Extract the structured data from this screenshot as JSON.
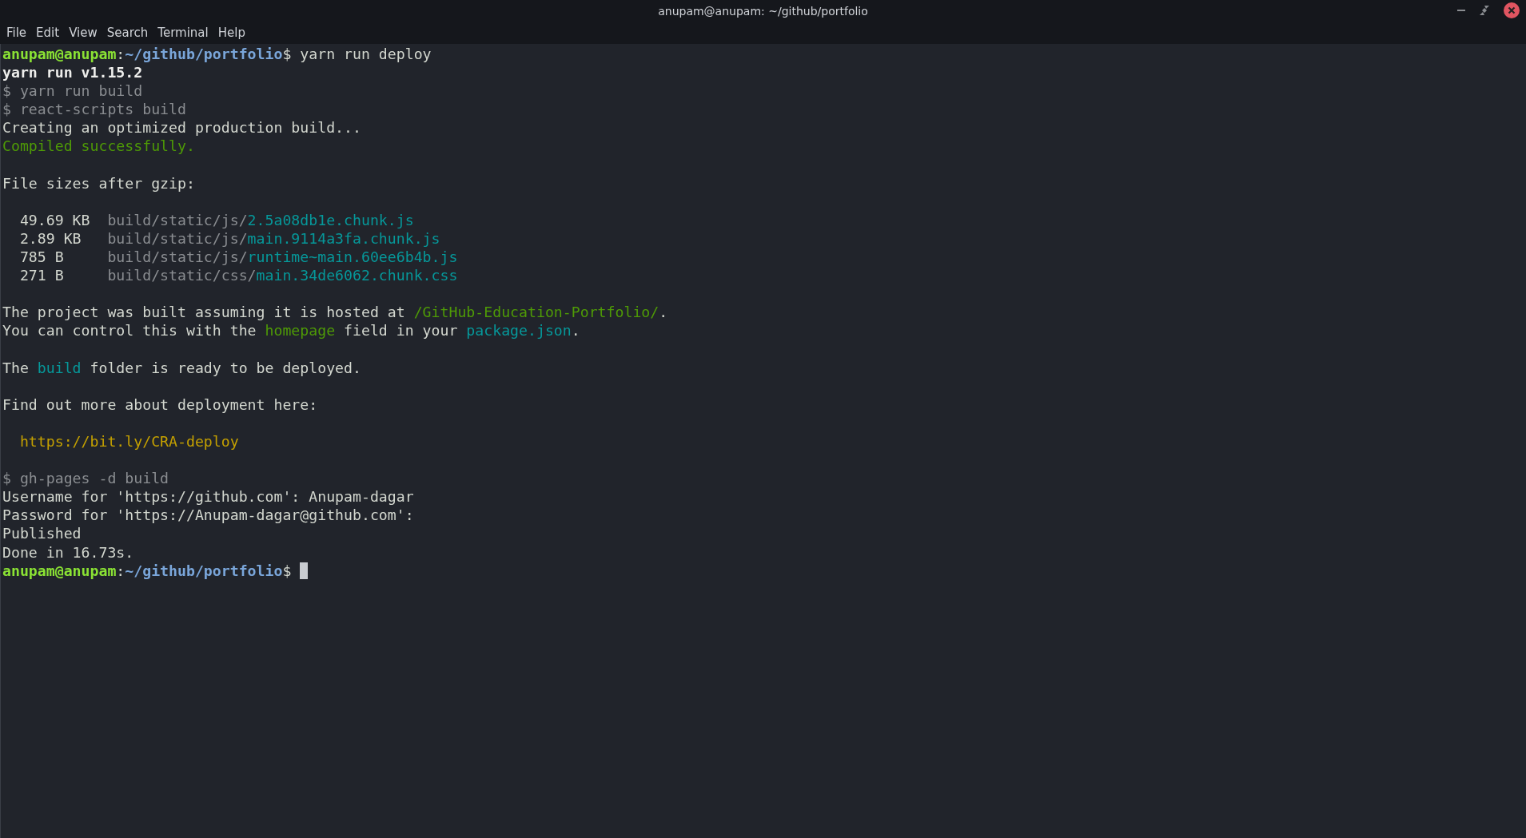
{
  "window": {
    "title": "anupam@anupam: ~/github/portfolio"
  },
  "menu": [
    "File",
    "Edit",
    "View",
    "Search",
    "Terminal",
    "Help"
  ],
  "lines": [
    {
      "kind": "text",
      "segments": [
        {
          "kind": "user",
          "text": "anupam@anupam"
        },
        {
          "kind": "normal",
          "text": ":"
        },
        {
          "kind": "path",
          "text": "~/github/portfolio"
        },
        {
          "kind": "normal",
          "text": "$ yarn run deploy"
        }
      ]
    },
    {
      "kind": "text",
      "segments": [
        {
          "kind": "bold",
          "text": "yarn run v1.15.2"
        }
      ]
    },
    {
      "kind": "text",
      "segments": [
        {
          "kind": "dim",
          "text": "$ yarn run build"
        }
      ]
    },
    {
      "kind": "text",
      "segments": [
        {
          "kind": "dim",
          "text": "$ react-scripts build"
        }
      ]
    },
    {
      "kind": "text",
      "segments": [
        {
          "kind": "normal",
          "text": "Creating an optimized production build..."
        }
      ]
    },
    {
      "kind": "text",
      "segments": [
        {
          "kind": "green",
          "text": "Compiled successfully."
        }
      ]
    },
    {
      "kind": "blank"
    },
    {
      "kind": "text",
      "segments": [
        {
          "kind": "normal",
          "text": "File sizes after gzip:"
        }
      ]
    },
    {
      "kind": "blank"
    },
    {
      "kind": "text",
      "segments": [
        {
          "kind": "normal",
          "text": "  49.69 KB  "
        },
        {
          "kind": "dim",
          "text": "build/static/js/"
        },
        {
          "kind": "cyan",
          "text": "2.5a08db1e.chunk.js"
        }
      ]
    },
    {
      "kind": "text",
      "segments": [
        {
          "kind": "normal",
          "text": "  2.89 KB   "
        },
        {
          "kind": "dim",
          "text": "build/static/js/"
        },
        {
          "kind": "cyan",
          "text": "main.9114a3fa.chunk.js"
        }
      ]
    },
    {
      "kind": "text",
      "segments": [
        {
          "kind": "normal",
          "text": "  785 B     "
        },
        {
          "kind": "dim",
          "text": "build/static/js/"
        },
        {
          "kind": "cyan",
          "text": "runtime~main.60ee6b4b.js"
        }
      ]
    },
    {
      "kind": "text",
      "segments": [
        {
          "kind": "normal",
          "text": "  271 B     "
        },
        {
          "kind": "dim",
          "text": "build/static/css/"
        },
        {
          "kind": "cyan",
          "text": "main.34de6062.chunk.css"
        }
      ]
    },
    {
      "kind": "blank"
    },
    {
      "kind": "text",
      "segments": [
        {
          "kind": "normal",
          "text": "The project was built assuming it is hosted at "
        },
        {
          "kind": "green",
          "text": "/GitHub-Education-Portfolio/"
        },
        {
          "kind": "normal",
          "text": "."
        }
      ]
    },
    {
      "kind": "text",
      "segments": [
        {
          "kind": "normal",
          "text": "You can control this with the "
        },
        {
          "kind": "green",
          "text": "homepage"
        },
        {
          "kind": "normal",
          "text": " field in your "
        },
        {
          "kind": "cyan",
          "text": "package.json"
        },
        {
          "kind": "normal",
          "text": "."
        }
      ]
    },
    {
      "kind": "blank"
    },
    {
      "kind": "text",
      "segments": [
        {
          "kind": "normal",
          "text": "The "
        },
        {
          "kind": "cyan",
          "text": "build"
        },
        {
          "kind": "normal",
          "text": " folder is ready to be deployed."
        }
      ]
    },
    {
      "kind": "blank"
    },
    {
      "kind": "text",
      "segments": [
        {
          "kind": "normal",
          "text": "Find out more about deployment here:"
        }
      ]
    },
    {
      "kind": "blank"
    },
    {
      "kind": "text",
      "segments": [
        {
          "kind": "yellow",
          "text": "  https://bit.ly/CRA-deploy"
        }
      ]
    },
    {
      "kind": "blank"
    },
    {
      "kind": "text",
      "segments": [
        {
          "kind": "dim",
          "text": "$ gh-pages -d build"
        }
      ]
    },
    {
      "kind": "text",
      "segments": [
        {
          "kind": "normal",
          "text": "Username for 'https://github.com': Anupam-dagar"
        }
      ]
    },
    {
      "kind": "text",
      "segments": [
        {
          "kind": "normal",
          "text": "Password for 'https://Anupam-dagar@github.com':"
        }
      ]
    },
    {
      "kind": "text",
      "segments": [
        {
          "kind": "normal",
          "text": "Published"
        }
      ]
    },
    {
      "kind": "text",
      "segments": [
        {
          "kind": "normal",
          "text": "Done in 16.73s."
        }
      ]
    },
    {
      "kind": "prompt",
      "segments": [
        {
          "kind": "user",
          "text": "anupam@anupam"
        },
        {
          "kind": "normal",
          "text": ":"
        },
        {
          "kind": "path",
          "text": "~/github/portfolio"
        },
        {
          "kind": "normal",
          "text": "$ "
        }
      ]
    }
  ]
}
